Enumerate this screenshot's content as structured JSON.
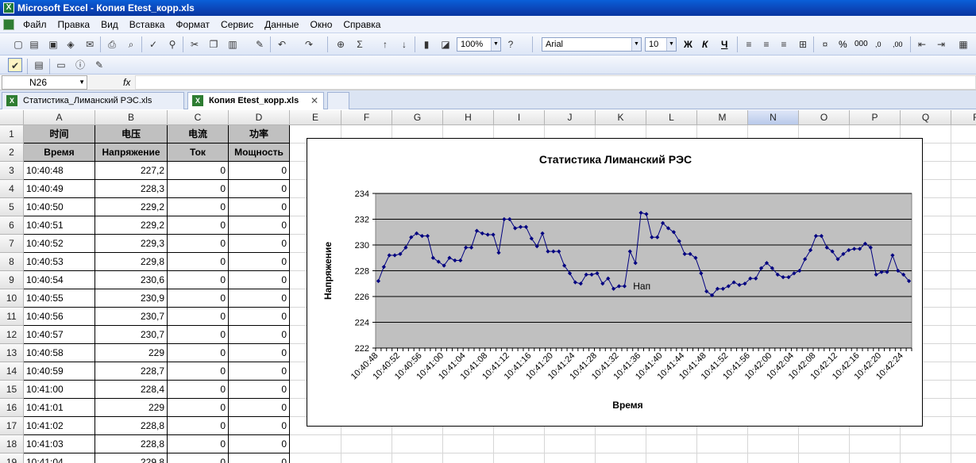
{
  "window": {
    "title": "Microsoft Excel - Копия Etest_корр.xls"
  },
  "menu": [
    "Файл",
    "Правка",
    "Вид",
    "Вставка",
    "Формат",
    "Сервис",
    "Данные",
    "Окно",
    "Справка"
  ],
  "toolbar": {
    "zoom": "100%",
    "font_name": "Arial",
    "font_size": "10",
    "bold_label": "Ж",
    "italic_label": "К",
    "underline_label": "Ч",
    "sigma_label": "Σ",
    "percent_label": "%",
    "thousands_label": "000",
    "decimals_inc_label": ",0",
    "decimals_dec_label": ",00"
  },
  "formula_bar": {
    "name_box": "N26",
    "fx_label": "fx",
    "formula": ""
  },
  "workbook_tabs": [
    {
      "label": "Статистика_Лиманский РЭС.xls",
      "active": false
    },
    {
      "label": "Копия Etest_корр.xls",
      "active": true
    }
  ],
  "colors": {
    "plot_area": "#c0c0c0",
    "series": "#000080",
    "header_fill": "#c0c0c0",
    "selected_col": "#b9c9ea"
  },
  "columns": [
    "A",
    "B",
    "C",
    "D",
    "E",
    "F",
    "G",
    "H",
    "I",
    "J",
    "K",
    "L",
    "M",
    "N",
    "O",
    "P",
    "Q",
    "R"
  ],
  "selected_column": "N",
  "rows": [
    "1",
    "2",
    "3",
    "4",
    "5",
    "6",
    "7",
    "8",
    "9",
    "10",
    "11",
    "12",
    "13",
    "14",
    "15",
    "16",
    "17",
    "18",
    "19"
  ],
  "sheet": {
    "header_row1": [
      "时间",
      "电压",
      "电流",
      "功率"
    ],
    "header_row2": [
      "Время",
      "Напряжение",
      "Ток",
      "Мощность"
    ],
    "data": [
      [
        "10:40:48",
        "227,2",
        "0",
        "0"
      ],
      [
        "10:40:49",
        "228,3",
        "0",
        "0"
      ],
      [
        "10:40:50",
        "229,2",
        "0",
        "0"
      ],
      [
        "10:40:51",
        "229,2",
        "0",
        "0"
      ],
      [
        "10:40:52",
        "229,3",
        "0",
        "0"
      ],
      [
        "10:40:53",
        "229,8",
        "0",
        "0"
      ],
      [
        "10:40:54",
        "230,6",
        "0",
        "0"
      ],
      [
        "10:40:55",
        "230,9",
        "0",
        "0"
      ],
      [
        "10:40:56",
        "230,7",
        "0",
        "0"
      ],
      [
        "10:40:57",
        "230,7",
        "0",
        "0"
      ],
      [
        "10:40:58",
        "229",
        "0",
        "0"
      ],
      [
        "10:40:59",
        "228,7",
        "0",
        "0"
      ],
      [
        "10:41:00",
        "228,4",
        "0",
        "0"
      ],
      [
        "10:41:01",
        "229",
        "0",
        "0"
      ],
      [
        "10:41:02",
        "228,8",
        "0",
        "0"
      ],
      [
        "10:41:03",
        "228,8",
        "0",
        "0"
      ],
      [
        "10:41:04",
        "229,8",
        "0",
        "0"
      ]
    ]
  },
  "chart_data": {
    "type": "line",
    "title": "Статистика Лиманский РЭС",
    "xlabel": "Время",
    "ylabel": "Напряжение",
    "ylim": [
      222,
      234
    ],
    "yticks": [
      222,
      224,
      226,
      228,
      230,
      232,
      234
    ],
    "grid": true,
    "annotation": "Нап",
    "x_tick_labels": [
      "10:40:48",
      "10:40:52",
      "10:40:56",
      "10:41:00",
      "10:41:04",
      "10:41:08",
      "10:41:12",
      "10:41:16",
      "10:41:20",
      "10:41:24",
      "10:41:28",
      "10:41:32",
      "10:41:36",
      "10:41:40",
      "10:41:44",
      "10:41:48",
      "10:41:52",
      "10:41:56",
      "10:42:00",
      "10:42:04",
      "10:42:08",
      "10:42:12",
      "10:42:16",
      "10:42:20",
      "10:42:24"
    ],
    "series": [
      {
        "values": [
          227.2,
          228.3,
          229.2,
          229.2,
          229.3,
          229.8,
          230.6,
          230.9,
          230.7,
          230.7,
          229.0,
          228.7,
          228.4,
          229.0,
          228.8,
          228.8,
          229.8,
          229.8,
          231.1,
          230.9,
          230.8,
          230.8,
          229.4,
          232.0,
          232.0,
          231.3,
          231.4,
          231.4,
          230.5,
          229.9,
          230.9,
          229.5,
          229.5,
          229.5,
          228.4,
          227.8,
          227.1,
          227.0,
          227.7,
          227.7,
          227.8,
          227.0,
          227.4,
          226.6,
          226.8,
          226.8,
          229.5,
          228.6,
          232.5,
          232.4,
          230.6,
          230.6,
          231.7,
          231.3,
          231.0,
          230.3,
          229.3,
          229.3,
          229.0,
          227.8,
          226.4,
          226.1,
          226.6,
          226.6,
          226.8,
          227.1,
          226.9,
          227.0,
          227.4,
          227.4,
          228.2,
          228.6,
          228.2,
          227.7,
          227.5,
          227.5,
          227.8,
          228.0,
          228.9,
          229.6,
          230.7,
          230.7,
          229.8,
          229.5,
          228.9,
          229.3,
          229.6,
          229.7,
          229.7,
          230.1,
          229.8,
          227.7,
          227.9,
          227.9,
          229.2,
          228.0,
          227.7,
          227.2
        ]
      }
    ]
  }
}
